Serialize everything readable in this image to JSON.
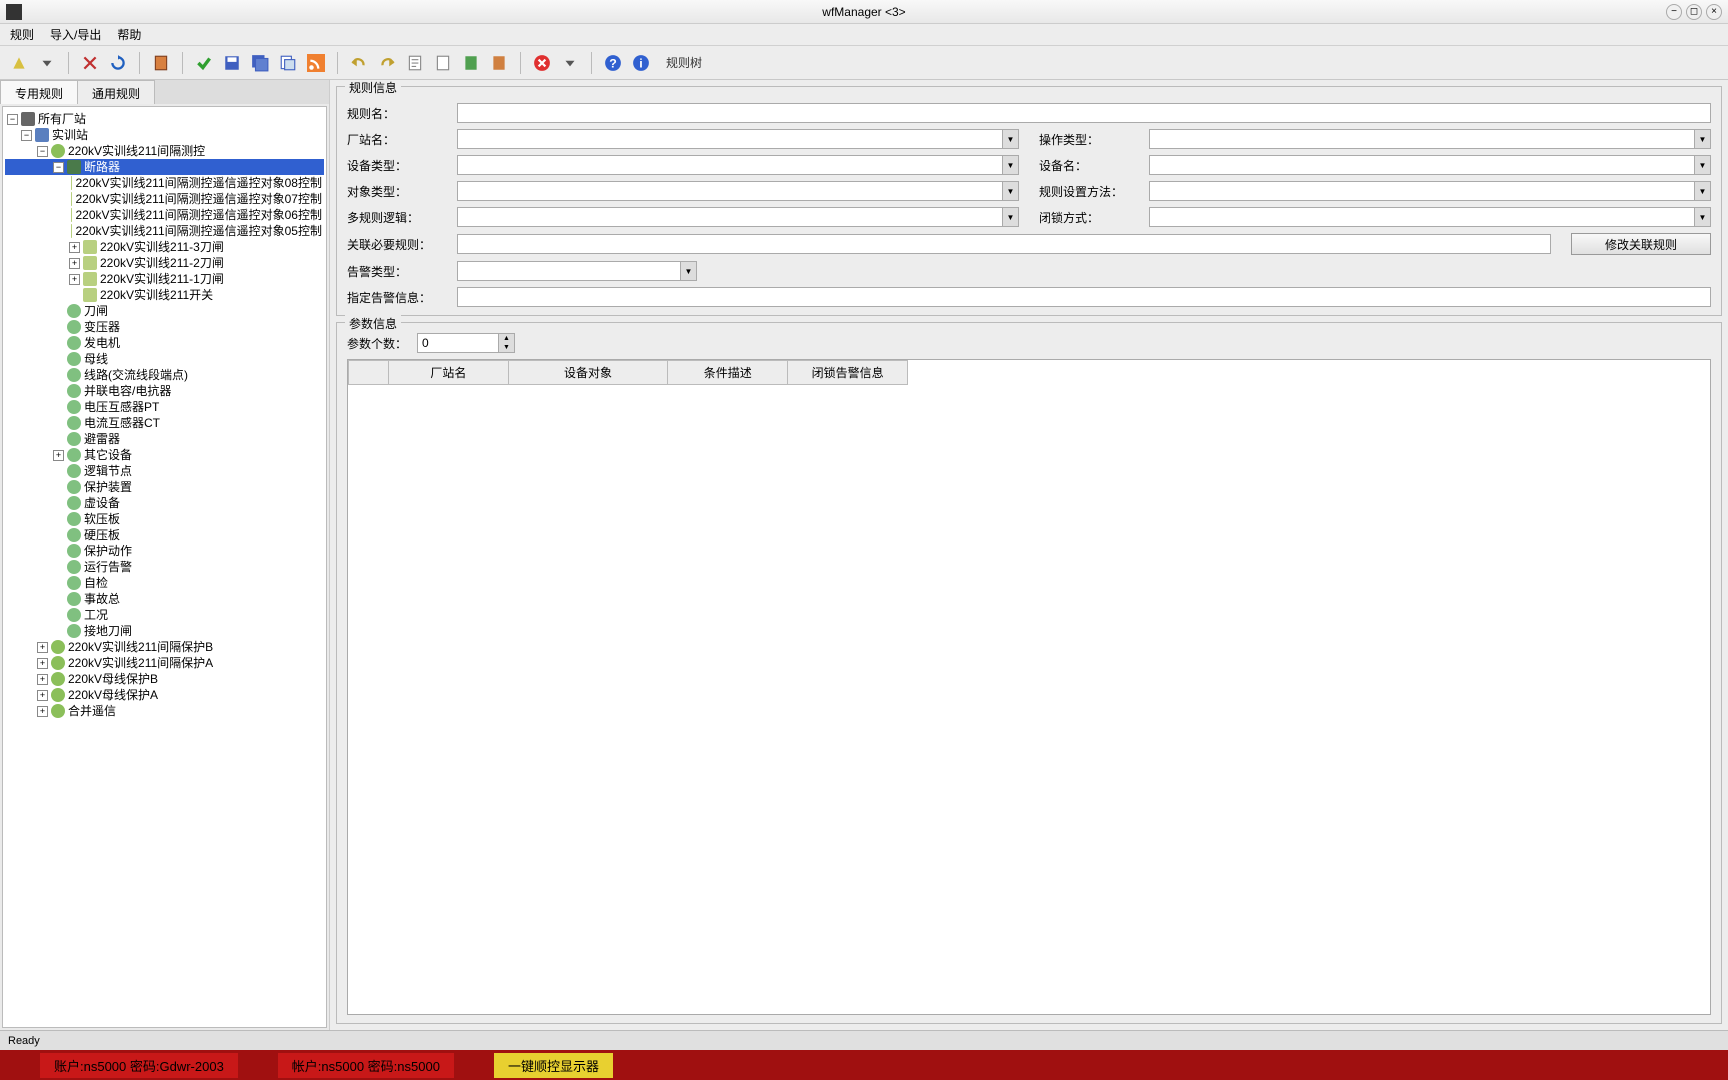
{
  "window": {
    "title": "wfManager <3>"
  },
  "menu": {
    "rules": "规则",
    "import_export": "导入/导出",
    "help": "帮助"
  },
  "toolbar": {
    "label_tree": "规则树"
  },
  "tabs": {
    "special": "专用规则",
    "general": "通用规则"
  },
  "tree": {
    "root": "所有厂站",
    "station": "实训站",
    "bay": "220kV实训线211间隔测控",
    "breaker": "断路器",
    "ctrl08": "220kV实训线211间隔测控遥信遥控对象08控制",
    "ctrl07": "220kV实训线211间隔测控遥信遥控对象07控制",
    "ctrl06": "220kV实训线211间隔测控遥信遥控对象06控制",
    "ctrl05": "220kV实训线211间隔测控遥信遥控对象05控制",
    "sw211_3": "220kV实训线211-3刀闸",
    "sw211_2": "220kV实训线211-2刀闸",
    "sw211_1": "220kV实训线211-1刀闸",
    "sw211": "220kV实训线211开关",
    "knife": "刀闸",
    "transformer": "变压器",
    "generator": "发电机",
    "bus": "母线",
    "line": "线路(交流线段端点)",
    "shunt": "并联电容/电抗器",
    "pt": "电压互感器PT",
    "ct": "电流互感器CT",
    "arrester": "避雷器",
    "other_dev": "其它设备",
    "logic_node": "逻辑节点",
    "protect_dev": "保护装置",
    "virtual_dev": "虚设备",
    "softplate": "软压板",
    "hardplate": "硬压板",
    "protect_act": "保护动作",
    "run_alarm": "运行告警",
    "self_check": "自检",
    "accident": "事故总",
    "condition": "工况",
    "ground_knife": "接地刀闸",
    "bay_protectB": "220kV实训线211间隔保护B",
    "bay_protectA": "220kV实训线211间隔保护A",
    "bus_protectB": "220kV母线保护B",
    "bus_protectA": "220kV母线保护A",
    "merge": "合并遥信"
  },
  "form": {
    "group_rule_info": "规则信息",
    "rule_name": "规则名：",
    "station_name": "厂站名：",
    "op_type": "操作类型：",
    "dev_type": "设备类型：",
    "dev_name": "设备名：",
    "obj_type": "对象类型：",
    "rule_method": "规则设置方法：",
    "multi_logic": "多规则逻辑：",
    "lock_mode": "闭锁方式：",
    "assoc_rule": "关联必要规则：",
    "modify_assoc": "修改关联规则",
    "alarm_type": "告警类型：",
    "alarm_info": "指定告警信息：",
    "group_param_info": "参数信息",
    "param_count": "参数个数：",
    "param_count_val": "0"
  },
  "table": {
    "col_blank": "",
    "col_station": "厂站名",
    "col_device": "设备对象",
    "col_condition": "条件描述",
    "col_lock_alarm": "闭锁告警信息"
  },
  "status": {
    "ready": "Ready"
  },
  "strip": {
    "item1": "账户:ns5000 密码:Gdwr-2003",
    "item2": "帐户:ns5000 密码:ns5000",
    "item3": "一键顺控显示器"
  }
}
